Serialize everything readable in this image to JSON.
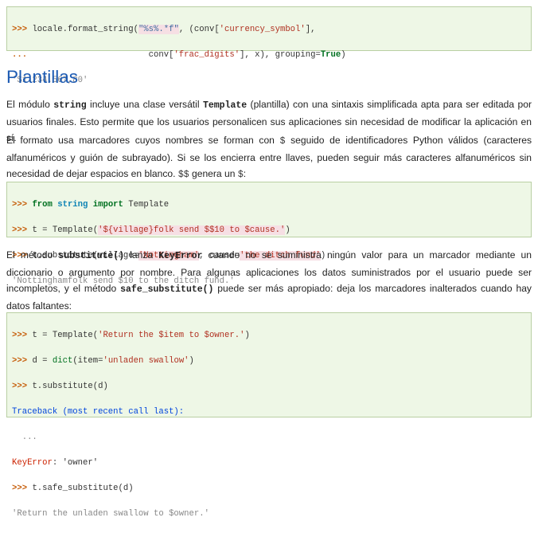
{
  "code1": {
    "l1_prompt": ">>> ",
    "l1_a": "locale.format_string(",
    "l1_s": "\"%s%.*f\"",
    "l1_b": ", (conv[",
    "l1_s2": "'currency_symbol'",
    "l1_c": "],",
    "l2_prompt": "...",
    "l2_pad": "                        ",
    "l2_a": "conv[",
    "l2_s": "'frac_digits'",
    "l2_b": "], x), grouping=",
    "l2_kw": "True",
    "l2_c": ")",
    "out": "'$1.234.567,80'"
  },
  "heading": "Plantillas",
  "para1": {
    "t1": "El módulo ",
    "c1": "string",
    "t2": " incluye una clase versátil ",
    "c2": "Template",
    "t3": " (plantilla) con una sintaxis simplificada apta para ser editada por usuarios finales. Esto permite que los usuarios personalicen sus aplicaciones sin necesidad de modificar la aplicación en sí."
  },
  "para2": {
    "t1": "El formato usa marcadores cuyos nombres se forman con ",
    "c1": "$",
    "t2": " seguido de identificadores Python válidos (caracteres alfanuméricos y guión de subrayado). Si se los encierra entre llaves, pueden seguir más caracteres alfanuméricos sin necesidad de dejar espacios en blanco. ",
    "c2": "$$",
    "t3": " genera un ",
    "c3": "$",
    "t4": ":"
  },
  "code2": {
    "l1_prompt": ">>> ",
    "l1_kw1": "from",
    "l1_nm": "string",
    "l1_kw2": "import",
    "l1_rest": " Template",
    "l2_prompt": ">>> ",
    "l2_a": "t = Template(",
    "l2_s": "'${village}folk send $$10 to $cause.'",
    "l2_b": ")",
    "l3_prompt": ">>> ",
    "l3_a": "t.substitute(village=",
    "l3_s": "'Nottingham'",
    "l3_b": ", cause=",
    "l3_s2": "'the ditch fund'",
    "l3_c": ")",
    "out": "'Nottinghamfolk send $10 to the ditch fund.'"
  },
  "para3": {
    "t1": "El método ",
    "c1": "substitute()",
    "t2": " lanza ",
    "c2": "KeyError",
    "t3": " cuando no se suministra ningún valor para un marcador mediante un diccionario o argumento por nombre. Para algunas aplicaciones los datos suministrados por el usuario puede ser incompletos, y el método ",
    "c3": "safe_substitute()",
    "t4": " puede ser más apropiado: deja los marcadores inalterados cuando hay datos faltantes:"
  },
  "code3": {
    "l1_prompt": ">>> ",
    "l1_a": "t = Template(",
    "l1_s": "'Return the $item to $owner.'",
    "l1_b": ")",
    "l2_prompt": ">>> ",
    "l2_a": "d = ",
    "l2_bi": "dict",
    "l2_b": "(item=",
    "l2_s": "'unladen swallow'",
    "l2_c": ")",
    "l3_prompt": ">>> ",
    "l3_a": "t.substitute(d)",
    "l4": "Traceback (most recent call last):",
    "l5": "  ...",
    "l6_err": "KeyError",
    "l6_rest": ": 'owner'",
    "l7_prompt": ">>> ",
    "l7_a": "t.safe_substitute(d)",
    "out": "'Return the unladen swallow to $owner.'"
  }
}
